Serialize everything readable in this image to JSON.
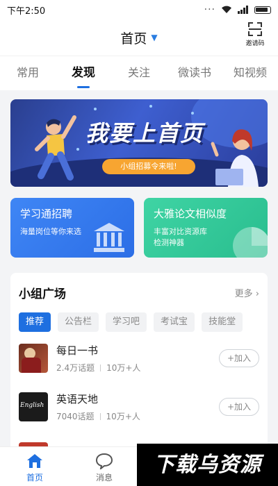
{
  "status_bar": {
    "time": "下午2:50",
    "dots": "···"
  },
  "header": {
    "title": "首页",
    "scan_label": "邀请码"
  },
  "tabs": [
    {
      "label": "常用"
    },
    {
      "label": "发现"
    },
    {
      "label": "关注"
    },
    {
      "label": "微读书"
    },
    {
      "label": "知视频"
    }
  ],
  "banner": {
    "title": "我要上首页",
    "pill": "小组招募令来啦!"
  },
  "cards": {
    "left": {
      "title": "学习通招聘",
      "sub": "海量岗位等你来选"
    },
    "right": {
      "title": "大雅论文相似度",
      "sub_line1": "丰富对比资源库",
      "sub_line2": "检测神器"
    }
  },
  "group": {
    "title": "小组广场",
    "more": "更多",
    "chips": [
      "推荐",
      "公告栏",
      "学习吧",
      "考试宝",
      "技能堂"
    ],
    "items": [
      {
        "name": "每日一书",
        "topics": "2.4万话题",
        "members": "10万+人",
        "join": "+加入"
      },
      {
        "name": "英语天地",
        "topics": "7040话题",
        "members": "10万+人",
        "join": "+加入"
      }
    ],
    "thumb_text": "English"
  },
  "bottom_nav": [
    {
      "label": "首页"
    },
    {
      "label": "消息"
    }
  ],
  "watermark": "下载乌资源",
  "colors": {
    "accent": "#1e6fe0",
    "card_blue": "#3f86f5",
    "card_green": "#3fd4a4",
    "pill": "#f7a531"
  }
}
